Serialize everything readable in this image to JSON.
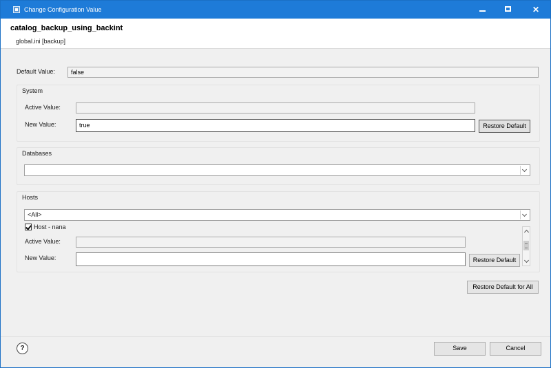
{
  "window": {
    "title": "Change Configuration Value"
  },
  "header": {
    "parameter_name": "catalog_backup_using_backint",
    "parameter_location": "global.ini [backup]"
  },
  "default_value": {
    "label": "Default Value:",
    "value": "false"
  },
  "system": {
    "title": "System",
    "active_label": "Active Value:",
    "active_value": "",
    "new_label": "New Value:",
    "new_value": "true",
    "restore_label": "Restore Default"
  },
  "databases": {
    "title": "Databases",
    "selected": ""
  },
  "hosts": {
    "title": "Hosts",
    "selected": "<All>",
    "host_item": {
      "checked": true,
      "label": "Host - nana",
      "active_label": "Active Value:",
      "active_value": "",
      "new_label": "New Value:",
      "new_value": "",
      "restore_label": "Restore Default"
    },
    "restore_all_label": "Restore Default for All"
  },
  "footer": {
    "help_glyph": "?",
    "save_label": "Save",
    "cancel_label": "Cancel"
  },
  "colors": {
    "titlebar": "#1e7bd8",
    "dialog_bg": "#f0f0f0"
  }
}
